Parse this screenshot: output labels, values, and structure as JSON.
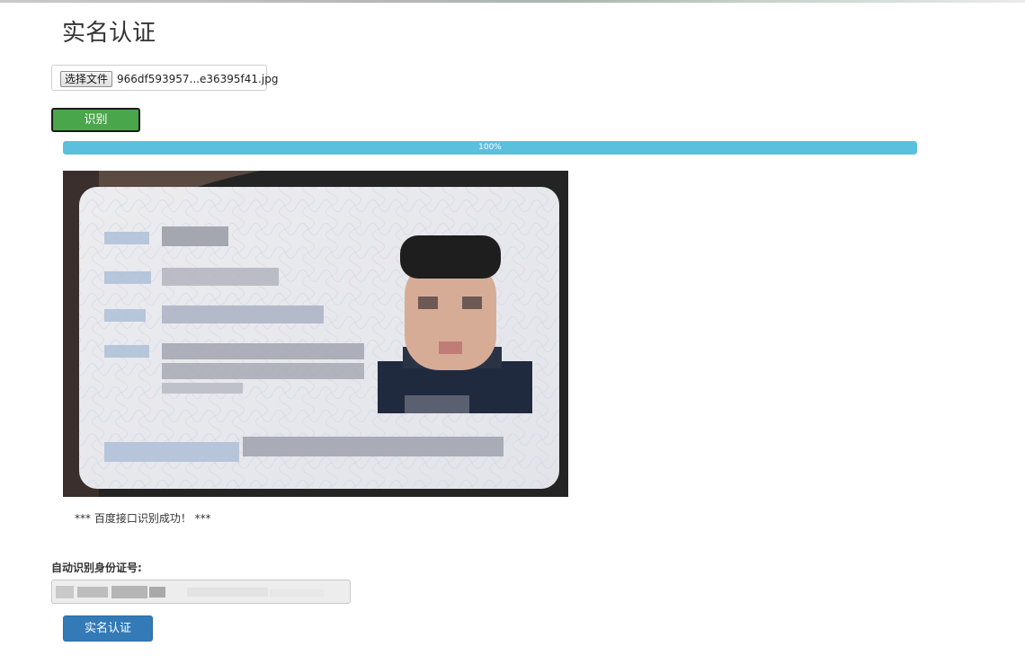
{
  "page": {
    "title": "实名认证"
  },
  "upload": {
    "button_label": "选择文件",
    "file_name": "966df593957...e36395f41.jpg"
  },
  "recognize_button": {
    "label": "识别",
    "color": "#4aa64a"
  },
  "progress": {
    "value_percent": 100,
    "label": "100%",
    "color": "#5bc0de"
  },
  "result": {
    "message": "*** 百度接口识别成功！ ***"
  },
  "id_number": {
    "label": "自动识别身份证号:",
    "value": ""
  },
  "verify_button": {
    "label": "实名认证",
    "color": "#337ab7"
  }
}
